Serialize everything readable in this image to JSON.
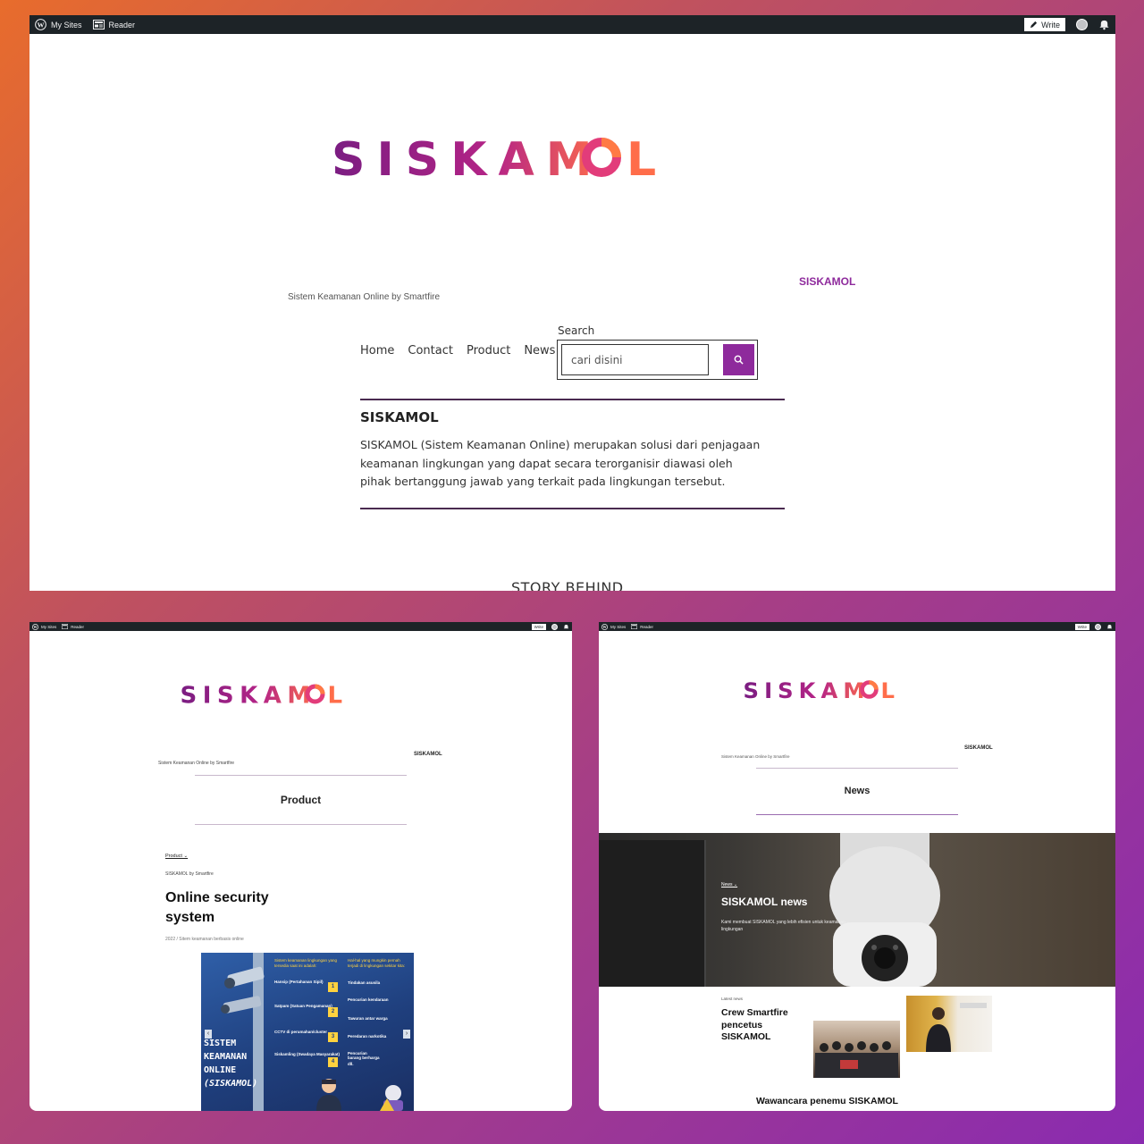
{
  "colors": {
    "logo_start": "#7a1d82",
    "logo_end": "#ff6d4a",
    "accent": "#8e2a9c",
    "admin_bar": "#1d2327"
  },
  "admin_bar": {
    "my_sites": "My Sites",
    "reader": "Reader",
    "write": "Write",
    "icons": [
      "wordpress-icon",
      "reader-icon",
      "pencil-icon",
      "avatar",
      "notifications-icon"
    ]
  },
  "home": {
    "logo": "SISKAMOL",
    "site_title": "SISKAMOL",
    "tagline": "Sistem Keamanan Online by Smartfire",
    "nav": [
      "Home",
      "Contact",
      "Product",
      "News"
    ],
    "search": {
      "label": "Search",
      "placeholder": "cari disini"
    },
    "intro": {
      "heading": "SISKAMOL",
      "body": "SISKAMOL (Sistem Keamanan Online) merupakan solusi dari penjagaan keamanan lingkungan yang dapat secara terorganisir diawasi oleh pihak bertanggung jawab yang terkait pada lingkungan tersebut."
    },
    "section_heading": "STORY BEHIND"
  },
  "product_page": {
    "logo": "SISKAMOL",
    "site_title": "SISKAMOL",
    "tagline": "Sistem Keamanan Online by Smartfire",
    "page_title": "Product",
    "category": "Product",
    "author": "SISKAMOL by Smartfire",
    "post_title_line1": "Online security",
    "post_title_line2": "system",
    "post_meta": "2022 / Sitem keamanan berbasis online",
    "infographic": {
      "title_lines": [
        "SISTEM",
        "KEAMANAN",
        "ONLINE",
        "(SISKAMOL)"
      ],
      "left_heading": "Sistem keamanan lingkungan yang tersedia saat ini adalah:",
      "left_items": [
        "Hansip (Pertahanan Sipil)",
        "Satpam (Satuan Pengamanan)",
        "CCTV di perumahan/cluster",
        "Siskamling (Swadaya Masyarakat)"
      ],
      "right_heading": "Hal-hal yang mungkin pernah terjadi di lingkungan sekitar kita:",
      "right_items": [
        "Tindakan asusila",
        "Pencurian kendaraan",
        "Tawuran antar warga",
        "Peredaran narkotika",
        "Pencurian barang berharga",
        "dll."
      ]
    }
  },
  "news_page": {
    "logo": "SISKAMOL",
    "site_title": "SISKAMOL",
    "tagline": "Sistem Keamanan Online by Smartfire",
    "page_title": "News",
    "hero": {
      "category": "News",
      "title": "SISKAMOL news",
      "excerpt": "Kami membuat SISKAMOL yang lebih efisien untuk keamanan lingkungan"
    },
    "latest_label": "Latest news",
    "latest_title_lines": [
      "Crew Smartfire",
      "pencetus",
      "SISKAMOL"
    ],
    "next_heading": "Wawancara penemu SISKAMOL"
  }
}
